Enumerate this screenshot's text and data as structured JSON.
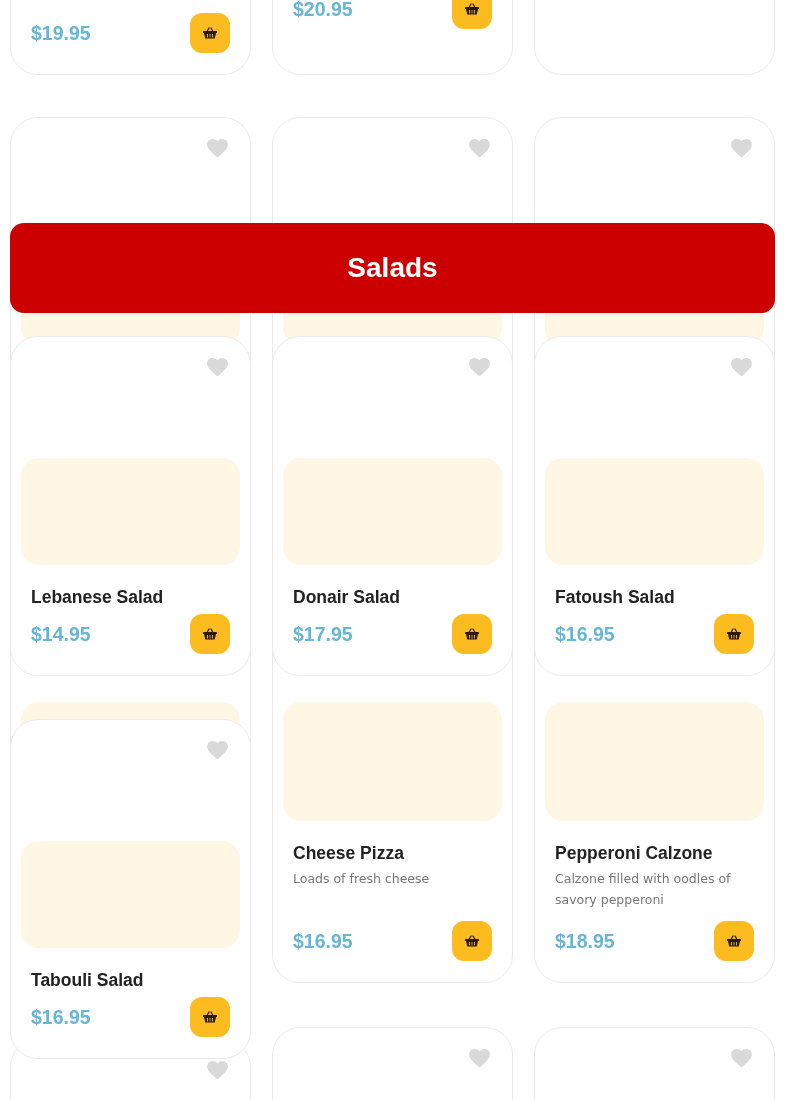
{
  "columns": [
    {
      "cards": [
        {
          "kind": "card",
          "price": "$19.95"
        },
        {
          "kind": "card",
          "favorite": false,
          "image": true
        },
        {
          "kind": "card",
          "favorite": false,
          "image": true,
          "name": "Lebanese Salad",
          "price": "$14.95"
        },
        {
          "kind": "card",
          "image": true
        },
        {
          "kind": "card",
          "favorite": false,
          "image": true,
          "name": "Tabouli Salad",
          "price": "$16.95"
        },
        {
          "kind": "card",
          "favorite": false
        }
      ]
    },
    {
      "cards": [
        {
          "kind": "card",
          "price": "$20.95"
        },
        {
          "kind": "card",
          "favorite": false,
          "image": true
        },
        {
          "kind": "card",
          "favorite": false,
          "image": true,
          "name": "Donair Salad",
          "price": "$17.95"
        },
        {
          "kind": "card",
          "image": true,
          "name": "Cheese Pizza",
          "description": "Loads of fresh cheese",
          "price": "$16.95"
        },
        {
          "kind": "card",
          "favorite": false
        }
      ]
    },
    {
      "cards": [
        {
          "kind": "card"
        },
        {
          "kind": "card",
          "favorite": false,
          "image": true
        },
        {
          "kind": "card",
          "favorite": false,
          "image": true,
          "name": "Fatoush Salad",
          "price": "$16.95"
        },
        {
          "kind": "card",
          "image": true,
          "name": "Pepperoni Calzone",
          "description": "Calzone filled with oodles of savory pepperoni",
          "price": "$18.95"
        },
        {
          "kind": "card",
          "favorite": false
        }
      ]
    }
  ],
  "banner": {
    "title": "Salads"
  }
}
